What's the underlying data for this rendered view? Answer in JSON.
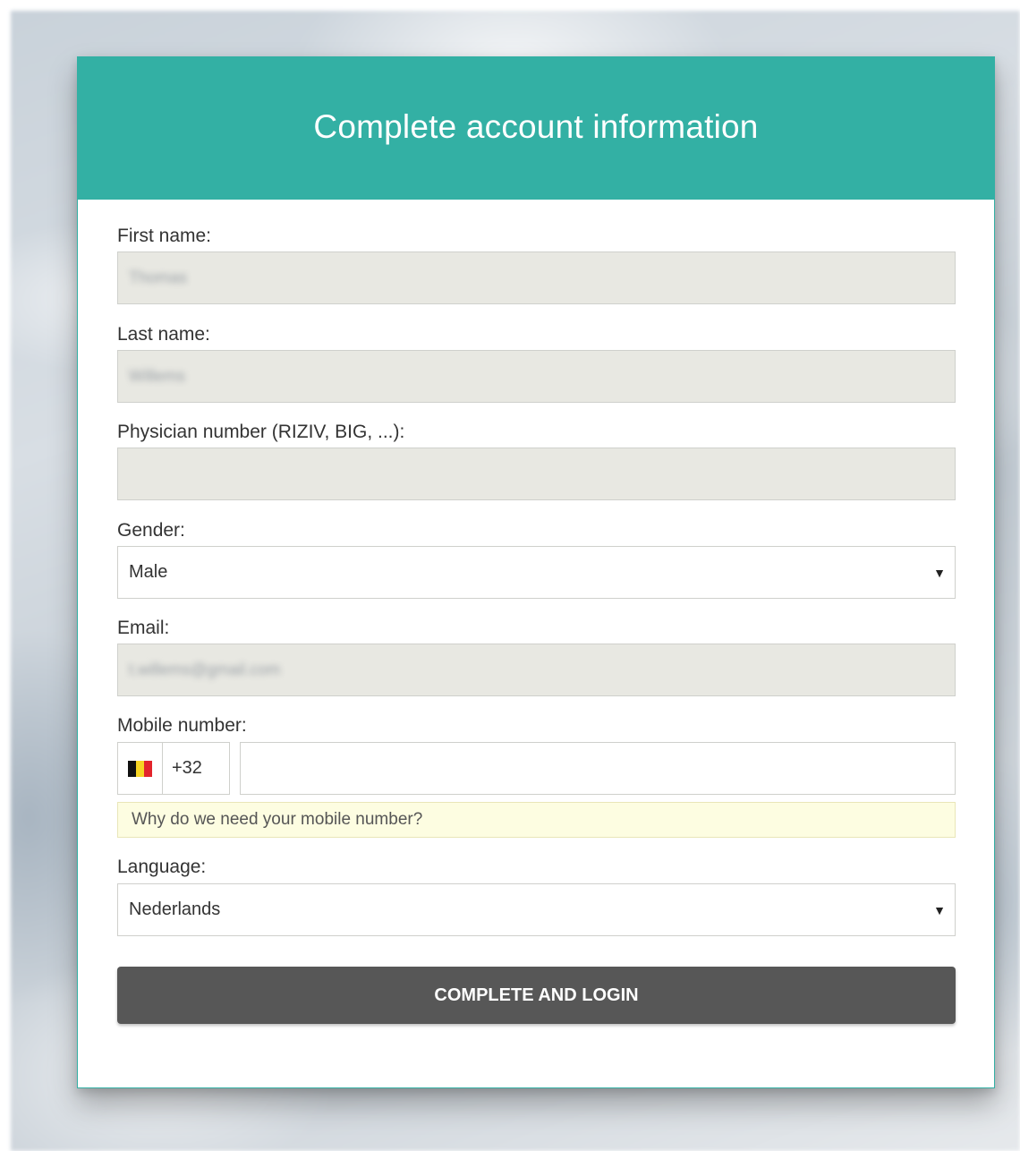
{
  "header": {
    "title": "Complete account information"
  },
  "form": {
    "first_name": {
      "label": "First name:",
      "value": "Thomas"
    },
    "last_name": {
      "label": "Last name:",
      "value": "Willems"
    },
    "physician_number": {
      "label": "Physician number (RIZIV, BIG, ...):",
      "value": ""
    },
    "gender": {
      "label": "Gender:",
      "selected": "Male",
      "caret_icon": "caret-down-icon"
    },
    "email": {
      "label": "Email:",
      "value": "t.willems@gmail.com"
    },
    "mobile": {
      "label": "Mobile number:",
      "country_flag": "belgium-flag-icon",
      "dial_code": "+32",
      "value": "",
      "help_text": "Why do we need your mobile number?"
    },
    "language": {
      "label": "Language:",
      "selected": "Nederlands",
      "caret_icon": "caret-down-icon"
    },
    "submit_label": "COMPLETE AND LOGIN"
  },
  "colors": {
    "header_bg": "#33b0a4",
    "readonly_bg": "#e8e8e2",
    "help_bg": "#fdfde1",
    "button_bg": "#575757"
  }
}
